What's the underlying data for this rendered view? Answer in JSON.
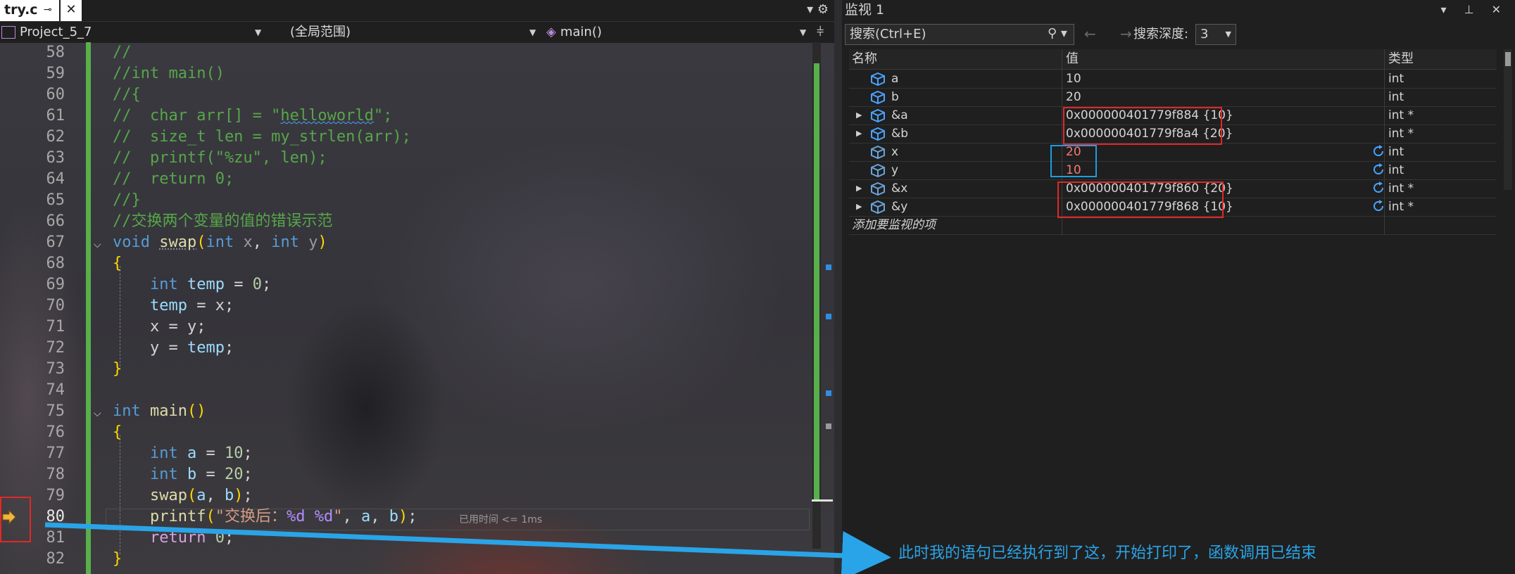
{
  "editor": {
    "tab": {
      "title": "try.c",
      "pin": "⊸",
      "close": "✕"
    },
    "tab_bar_icons": "▾ ⚙",
    "nav": {
      "project": "Project_5_7",
      "scope": "(全局范围)",
      "function": "main()"
    },
    "elapsed": "已用时间 <= 1ms",
    "lines": [
      {
        "n": "58"
      },
      {
        "n": "59"
      },
      {
        "n": "60"
      },
      {
        "n": "61"
      },
      {
        "n": "62"
      },
      {
        "n": "63"
      },
      {
        "n": "64"
      },
      {
        "n": "65"
      },
      {
        "n": "66"
      },
      {
        "n": "67"
      },
      {
        "n": "68"
      },
      {
        "n": "69"
      },
      {
        "n": "70"
      },
      {
        "n": "71"
      },
      {
        "n": "72"
      },
      {
        "n": "73"
      },
      {
        "n": "74"
      },
      {
        "n": "75"
      },
      {
        "n": "76"
      },
      {
        "n": "77"
      },
      {
        "n": "78"
      },
      {
        "n": "79"
      },
      {
        "n": "80"
      },
      {
        "n": "81"
      },
      {
        "n": "82"
      }
    ],
    "code": {
      "l58": "//",
      "l59": "//int main()",
      "l60": "//{",
      "l61a": "//  char arr[] = \"",
      "l61b": "helloworld",
      "l61c": "\";",
      "l62": "//  size_t len = my_strlen(arr);",
      "l63": "//  printf(\"%zu\", len);",
      "l64": "//  return 0;",
      "l65": "//}",
      "l66": "//交换两个变量的值的错误示范",
      "kw_void": "void",
      "kw_int": "int",
      "fn_swap": "swap",
      "fn_main": "main",
      "fn_printf": "printf",
      "id_x": "x",
      "id_y": "y",
      "id_a": "a",
      "id_b": "b",
      "id_temp": "temp",
      "num_0": "0",
      "num_10": "10",
      "num_20": "20",
      "kw_return": "return",
      "str_prefix": "\"交换后：",
      "fmt_d1": "%d",
      "fmt_d2": "%d",
      "str_suffix": "\"",
      "brace_open": "{",
      "brace_close": "}"
    }
  },
  "watch": {
    "title": "监视 1",
    "title_icons": "▾ ⊥ ✕",
    "search_placeholder": "搜索(Ctrl+E)",
    "search_icon": "⚲ ▾",
    "nav_arrows": "← →",
    "depth_label": "搜索深度:",
    "depth_value": "3",
    "columns": {
      "name": "名称",
      "value": "值",
      "type": "类型"
    },
    "rows": [
      {
        "name": "a",
        "value": "10",
        "type": "int",
        "expandable": false,
        "refresh": false,
        "changed": false
      },
      {
        "name": "b",
        "value": "20",
        "type": "int",
        "expandable": false,
        "refresh": false,
        "changed": false
      },
      {
        "name": "&a",
        "value": "0x000000401779f884 {10}",
        "type": "int *",
        "expandable": true,
        "refresh": false,
        "changed": false
      },
      {
        "name": "&b",
        "value": "0x000000401779f8a4 {20}",
        "type": "int *",
        "expandable": true,
        "refresh": false,
        "changed": false
      },
      {
        "name": "x",
        "value": "20",
        "type": "int",
        "expandable": false,
        "refresh": true,
        "changed": true
      },
      {
        "name": "y",
        "value": "10",
        "type": "int",
        "expandable": false,
        "refresh": true,
        "changed": true
      },
      {
        "name": "&x",
        "value": "0x000000401779f860 {20}",
        "type": "int *",
        "expandable": true,
        "refresh": true,
        "changed": false
      },
      {
        "name": "&y",
        "value": "0x000000401779f868 {10}",
        "type": "int *",
        "expandable": true,
        "refresh": true,
        "changed": false
      }
    ],
    "add_watch": "添加要监视的项"
  },
  "annotation": {
    "text": "此时我的语句已经执行到了这，开始打印了，函数调用已结束",
    "color": "#2aa4e8"
  },
  "colors": {
    "comment": "#57a64a",
    "keyword": "#569cd6",
    "function": "#dcdcaa",
    "identifier": "#9cdcfe",
    "number": "#b5cea8",
    "string": "#d69d85",
    "format": "#b48cff",
    "git_bar": "#58b04a",
    "highlight_red": "#e02828",
    "highlight_blue": "#1e9de0"
  }
}
